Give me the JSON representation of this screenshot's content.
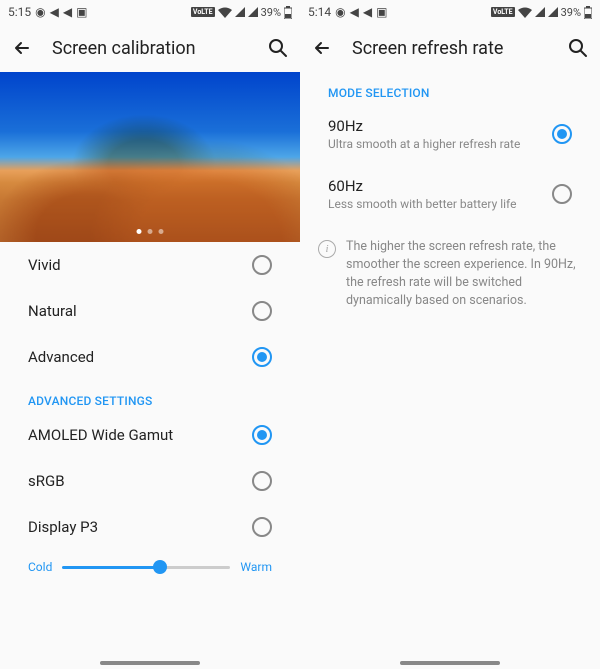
{
  "left": {
    "status": {
      "time": "5:15",
      "battery": "39%"
    },
    "title": "Screen calibration",
    "modes": [
      {
        "label": "Vivid",
        "selected": false
      },
      {
        "label": "Natural",
        "selected": false
      },
      {
        "label": "Advanced",
        "selected": true
      }
    ],
    "advanced_header": "ADVANCED SETTINGS",
    "advanced_modes": [
      {
        "label": "AMOLED Wide Gamut",
        "selected": true
      },
      {
        "label": "sRGB",
        "selected": false
      },
      {
        "label": "Display P3",
        "selected": false
      }
    ],
    "slider": {
      "cold": "Cold",
      "warm": "Warm",
      "value": 58
    }
  },
  "right": {
    "status": {
      "time": "5:14",
      "battery": "39%"
    },
    "title": "Screen refresh rate",
    "mode_header": "MODE SELECTION",
    "options": [
      {
        "label": "90Hz",
        "sub": "Ultra smooth at a higher refresh rate",
        "selected": true
      },
      {
        "label": "60Hz",
        "sub": "Less smooth with better battery life",
        "selected": false
      }
    ],
    "info": "The higher the screen refresh rate, the smoother the screen experience. In 90Hz, the refresh rate will be switched dynamically based on scenarios."
  }
}
